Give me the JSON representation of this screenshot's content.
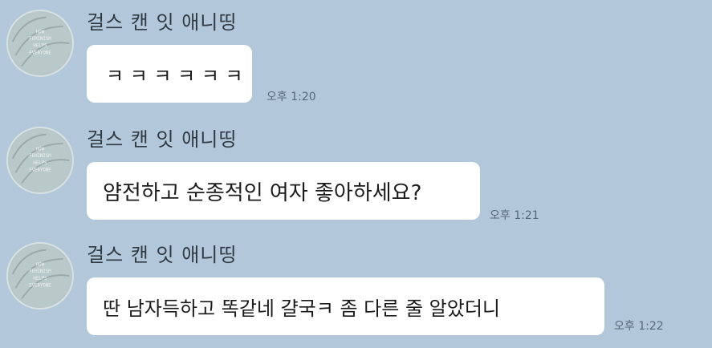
{
  "chat": {
    "messages": [
      {
        "sender": "걸스 캔 잇 애니띵",
        "text": "ㅋ ㅋ ㅋ ㅋ ㅋ ㅋ",
        "time": "오후 1:20",
        "avatar_icon": "feminism-badge-avatar"
      },
      {
        "sender": "걸스 캔 잇 애니띵",
        "text": "얌전하고 순종적인 여자 좋아하세요?",
        "time": "오후 1:21",
        "avatar_icon": "feminism-badge-avatar"
      },
      {
        "sender": "걸스 캔 잇 애니띵",
        "text": "딴 남자득하고 똑같네 걀국ㅋ 좀 다른 줄 알았더니",
        "time": "오후 1:22",
        "avatar_icon": "feminism-badge-avatar"
      }
    ],
    "avatar_text": [
      "HOW",
      "FEMINISM",
      "HELPS",
      "EVERYONE"
    ]
  },
  "colors": {
    "background": "#b2c7da",
    "bubble": "#ffffff",
    "time_text": "#576878",
    "sender_text": "#2f3a44"
  }
}
